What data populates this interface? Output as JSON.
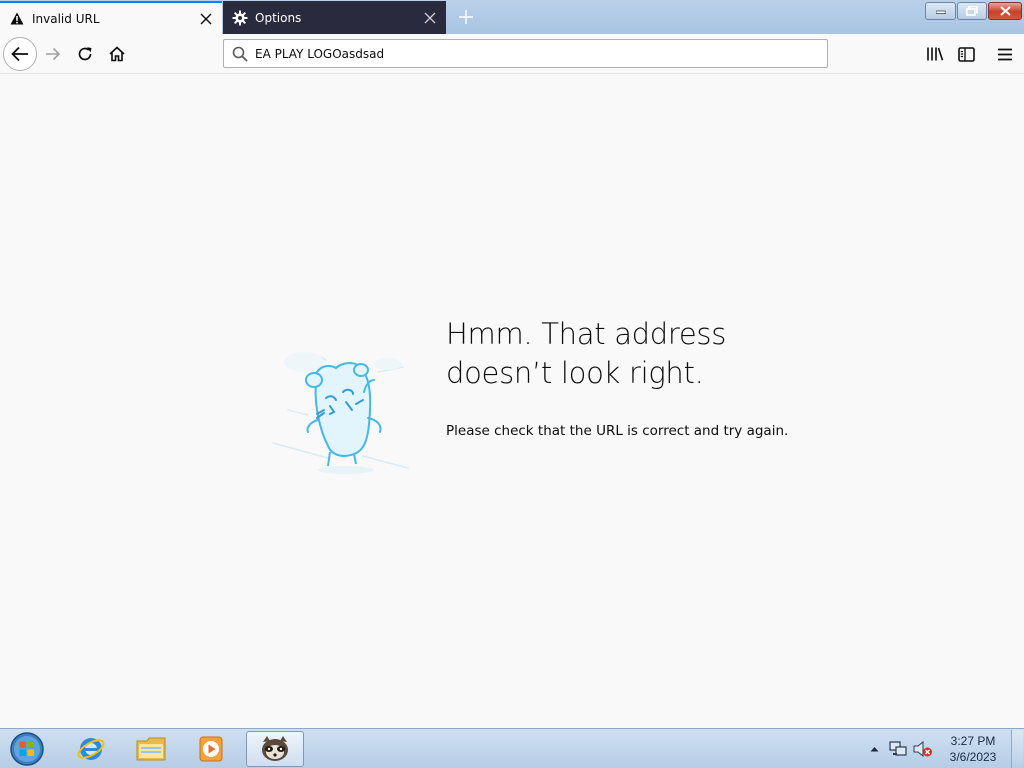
{
  "window": {
    "controls": {
      "minimize": "minimize-icon",
      "maximize": "maximize-icon",
      "close": "close-icon"
    }
  },
  "tabs": [
    {
      "label": "Invalid URL",
      "icon": "warning-icon",
      "active": true
    },
    {
      "label": "Options",
      "icon": "gear-icon",
      "active": false
    }
  ],
  "toolbar": {
    "url_value": "EA PLAY LOGOasdsad",
    "icons": [
      "back-arrow-icon",
      "forward-arrow-icon",
      "reload-icon",
      "home-icon",
      "search-icon",
      "library-icon",
      "sidebar-icon",
      "hamburger-menu-icon"
    ]
  },
  "error_page": {
    "title_line1": "Hmm. That address",
    "title_line2": "doesn’t look right.",
    "description": "Please check that the URL is correct and try again."
  },
  "taskbar": {
    "clock_time": "3:27 PM",
    "clock_date": "3/6/2023",
    "items": [
      "start-orb-icon",
      "internet-explorer-icon",
      "file-explorer-icon",
      "media-player-icon",
      "firefox-nightly-icon"
    ]
  },
  "colors": {
    "accent": "#0a84ff",
    "inactive_tab_bg": "#2a2a3e",
    "page_bg": "#f9f9fa",
    "illustration": "#45b8e6"
  }
}
